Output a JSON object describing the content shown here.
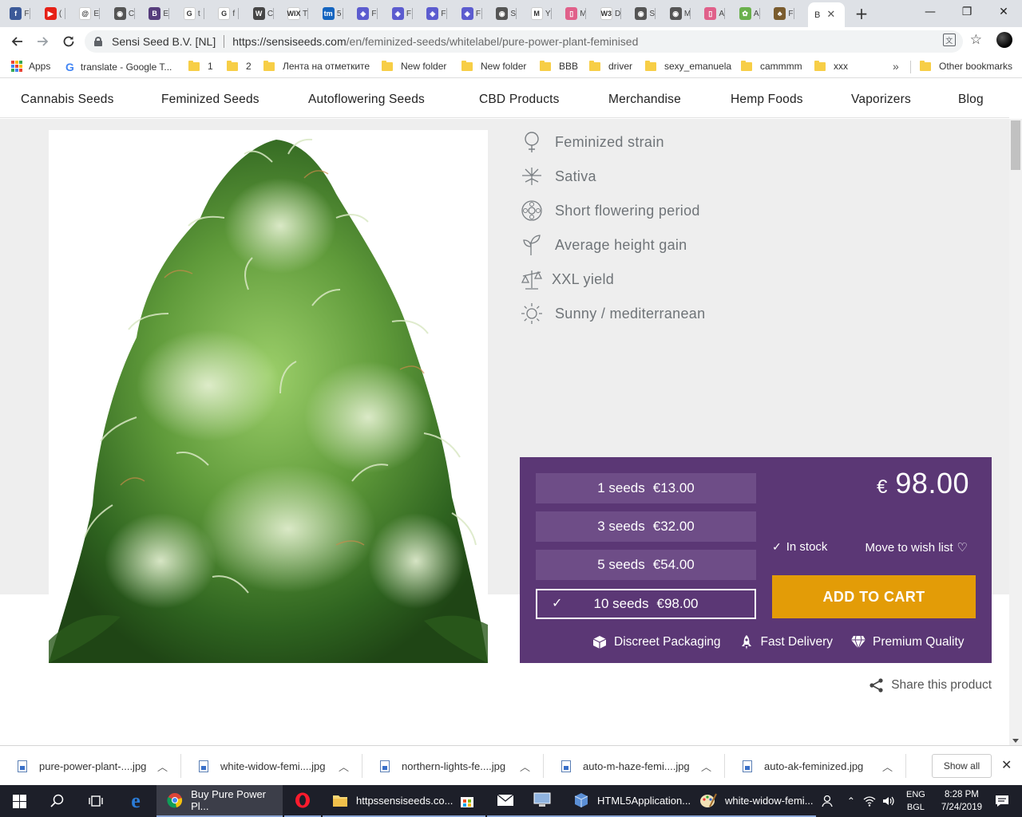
{
  "browser": {
    "tabs_mini": [
      {
        "icon": "facebook-icon",
        "text": "F",
        "color": "#3b5998",
        "glyph": "f"
      },
      {
        "icon": "youtube-icon",
        "text": "(",
        "color": "#e62117",
        "glyph": "▶"
      },
      {
        "icon": "swirl-icon",
        "text": "E",
        "color": "#ffffff",
        "glyph": "@"
      },
      {
        "icon": "globe-icon",
        "text": "C",
        "color": "#555555",
        "glyph": "◉"
      },
      {
        "icon": "bootstrap-icon",
        "text": "E",
        "color": "#563d7c",
        "glyph": "B"
      },
      {
        "icon": "google-icon",
        "text": "t",
        "color": "#ffffff",
        "glyph": "G"
      },
      {
        "icon": "google-icon",
        "text": "f",
        "color": "#ffffff",
        "glyph": "G"
      },
      {
        "icon": "wordpress-icon",
        "text": "C",
        "color": "#464646",
        "glyph": "W"
      },
      {
        "icon": "wix-icon",
        "text": "T",
        "color": "#ffffff",
        "glyph": "WIX"
      },
      {
        "icon": "tm-icon",
        "text": "5",
        "color": "#1565c0",
        "glyph": "tm"
      },
      {
        "icon": "shield-icon",
        "text": "F",
        "color": "#5c5ccf",
        "glyph": "◈"
      },
      {
        "icon": "shield-icon",
        "text": "F",
        "color": "#5c5ccf",
        "glyph": "◈"
      },
      {
        "icon": "shield-icon",
        "text": "F",
        "color": "#5c5ccf",
        "glyph": "◈"
      },
      {
        "icon": "shield-icon",
        "text": "F",
        "color": "#5c5ccf",
        "glyph": "◈"
      },
      {
        "icon": "globe-icon",
        "text": "S",
        "color": "#555555",
        "glyph": "◉"
      },
      {
        "icon": "gmail-icon",
        "text": "Y",
        "color": "#ffffff",
        "glyph": "M"
      },
      {
        "icon": "media-icon",
        "text": "M",
        "color": "#e0608a",
        "glyph": "▯"
      },
      {
        "icon": "w3schools-icon",
        "text": "D",
        "color": "#ffffff",
        "glyph": "W3"
      },
      {
        "icon": "globe-icon",
        "text": "S",
        "color": "#555555",
        "glyph": "◉"
      },
      {
        "icon": "globe-icon",
        "text": "M",
        "color": "#555555",
        "glyph": "◉"
      },
      {
        "icon": "media-icon",
        "text": "A",
        "color": "#e0608a",
        "glyph": "▯"
      },
      {
        "icon": "leaf-icon",
        "text": "A",
        "color": "#6ab04c",
        "glyph": "✿"
      },
      {
        "icon": "cannabis-icon",
        "text": "F",
        "color": "#7a5c2e",
        "glyph": "♣"
      }
    ],
    "active_tab": {
      "title": "B",
      "close": "✕"
    },
    "new_tab": "+",
    "window_controls": {
      "minimize": "—",
      "restore": "❐",
      "close": "✕"
    },
    "site_identity": "Sensi Seed B.V. [NL]",
    "url_host": "https://sensiseeds.com",
    "url_path": "/en/feminized-seeds/whitelabel/pure-power-plant-feminised"
  },
  "bookmarks": [
    {
      "label": "Apps",
      "type": "apps"
    },
    {
      "label": "translate - Google T...",
      "type": "google"
    },
    {
      "label": "1",
      "type": "folder"
    },
    {
      "label": "2",
      "type": "folder"
    },
    {
      "label": "Лента на отметките",
      "type": "folder"
    },
    {
      "label": "New folder",
      "type": "folder"
    },
    {
      "label": "New folder",
      "type": "folder"
    },
    {
      "label": "BBB",
      "type": "folder"
    },
    {
      "label": "driver",
      "type": "folder"
    },
    {
      "label": "sexy_emanuela",
      "type": "folder"
    },
    {
      "label": "cammmm",
      "type": "folder"
    },
    {
      "label": "xxx",
      "type": "folder"
    }
  ],
  "bookmarks_overflow": "»",
  "bookmarks_other": "Other bookmarks",
  "site_nav": [
    "Cannabis Seeds",
    "Feminized Seeds",
    "Autoflowering Seeds",
    "CBD Products",
    "Merchandise",
    "Hemp Foods",
    "Vaporizers",
    "Blog"
  ],
  "features": [
    {
      "icon": "female-symbol-icon",
      "label": "Feminized strain"
    },
    {
      "icon": "cannabis-leaf-icon",
      "label": "Sativa"
    },
    {
      "icon": "flower-clock-icon",
      "label": "Short flowering period"
    },
    {
      "icon": "sprout-icon",
      "label": "Average height gain"
    },
    {
      "icon": "scale-icon",
      "label": "XXL yield"
    },
    {
      "icon": "sun-icon",
      "label": "Sunny / mediterranean"
    }
  ],
  "seed_options": [
    {
      "count": "1 seeds",
      "price": "€13.00",
      "selected": false
    },
    {
      "count": "3 seeds",
      "price": "€32.00",
      "selected": false
    },
    {
      "count": "5 seeds",
      "price": "€54.00",
      "selected": false
    },
    {
      "count": "10 seeds",
      "price": "€98.00",
      "selected": true
    }
  ],
  "price": {
    "currency": "€",
    "amount": "98.00"
  },
  "stock_status": "In stock",
  "wishlist_label": "Move to wish list",
  "add_to_cart": "ADD TO CART",
  "perks": [
    {
      "icon": "box-icon",
      "label": "Discreet Packaging"
    },
    {
      "icon": "rocket-icon",
      "label": "Fast Delivery"
    },
    {
      "icon": "diamond-icon",
      "label": "Premium Quality"
    }
  ],
  "share_label": "Share this product",
  "downloads": [
    "pure-power-plant-....jpg",
    "white-widow-femi....jpg",
    "northern-lights-fe....jpg",
    "auto-m-haze-femi....jpg",
    "auto-ak-feminized.jpg"
  ],
  "downloads_show_all": "Show all",
  "taskbar": {
    "apps": [
      {
        "icon": "chrome-icon",
        "label": "Buy Pure Power Pl...",
        "active": true
      },
      {
        "icon": "opera-icon",
        "label": "",
        "active": false
      },
      {
        "icon": "folder-icon",
        "label": "httpssensiseeds.co...",
        "active": false
      },
      {
        "icon": "store-icon",
        "label": "",
        "active": false
      },
      {
        "icon": "mail-icon",
        "label": "",
        "active": false
      },
      {
        "icon": "computer-icon",
        "label": "",
        "active": false
      },
      {
        "icon": "cube-icon",
        "label": "HTML5Application...",
        "active": false
      },
      {
        "icon": "paint-icon",
        "label": "white-widow-femi...",
        "active": false
      }
    ],
    "lang_1": "ENG",
    "lang_2": "BGL",
    "time": "8:28 PM",
    "date": "7/24/2019"
  },
  "colors": {
    "buybox_bg": "#5b3775",
    "seed_option_bg": "#6e4d87",
    "add_to_cart_bg": "#e39c07",
    "feature_text": "#6f7478"
  }
}
